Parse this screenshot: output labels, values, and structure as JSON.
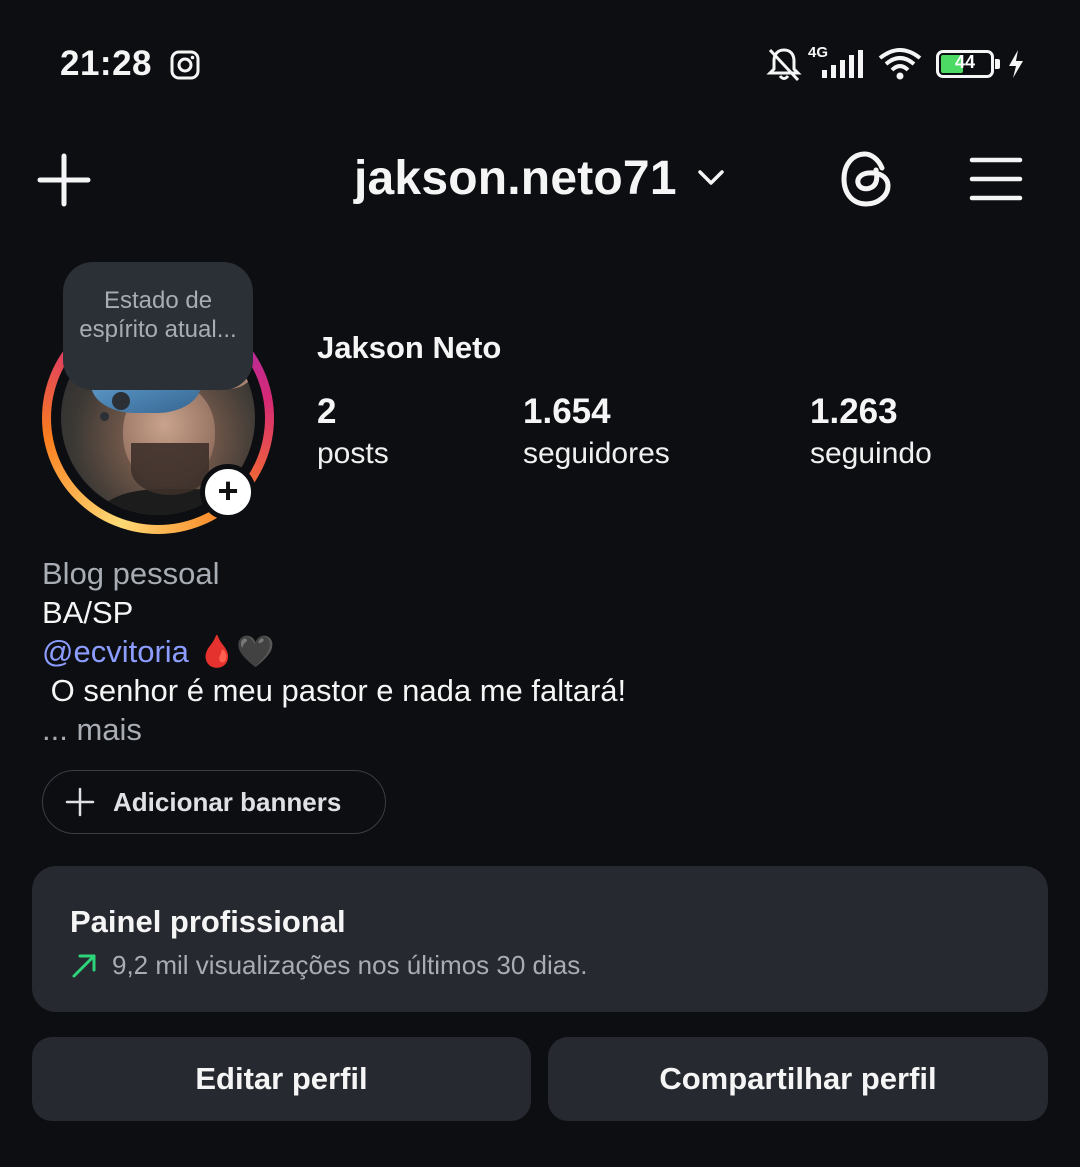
{
  "status_bar": {
    "time": "21:28",
    "network": "4G",
    "battery": "44",
    "icons": [
      "instagram-icon",
      "bell-muted-icon",
      "signal-icon",
      "wifi-icon",
      "battery-icon",
      "charging-icon"
    ]
  },
  "header": {
    "username": "jakson.neto71",
    "icons": [
      "plus-icon",
      "chevron-down-icon",
      "threads-icon",
      "menu-icon"
    ]
  },
  "profile": {
    "note": "Estado de espírito atual...",
    "display_name": "Jakson Neto",
    "stats": [
      {
        "value": "2",
        "label": "posts"
      },
      {
        "value": "1.654",
        "label": "seguidores"
      },
      {
        "value": "1.263",
        "label": "seguindo"
      }
    ]
  },
  "bio": {
    "category": "Blog pessoal",
    "location": "BA/SP",
    "threads_symbol": "@",
    "handle_text": "ecvitoria",
    "emojis": "🩸🖤",
    "quote": " O senhor é meu pastor e nada me faltará!",
    "more": "... mais"
  },
  "banners": {
    "label": "Adicionar banners"
  },
  "dashboard": {
    "title": "Painel profissional",
    "subtitle": "9,2 mil visualizações nos últimos 30 dias.",
    "accent": "#2ed47a"
  },
  "actions": {
    "edit": "Editar perfil",
    "share": "Compartilhar perfil"
  },
  "colors": {
    "background": "#0c0e12",
    "card": "#26292f",
    "link": "#8c9dff",
    "battery": "#4cd964"
  }
}
